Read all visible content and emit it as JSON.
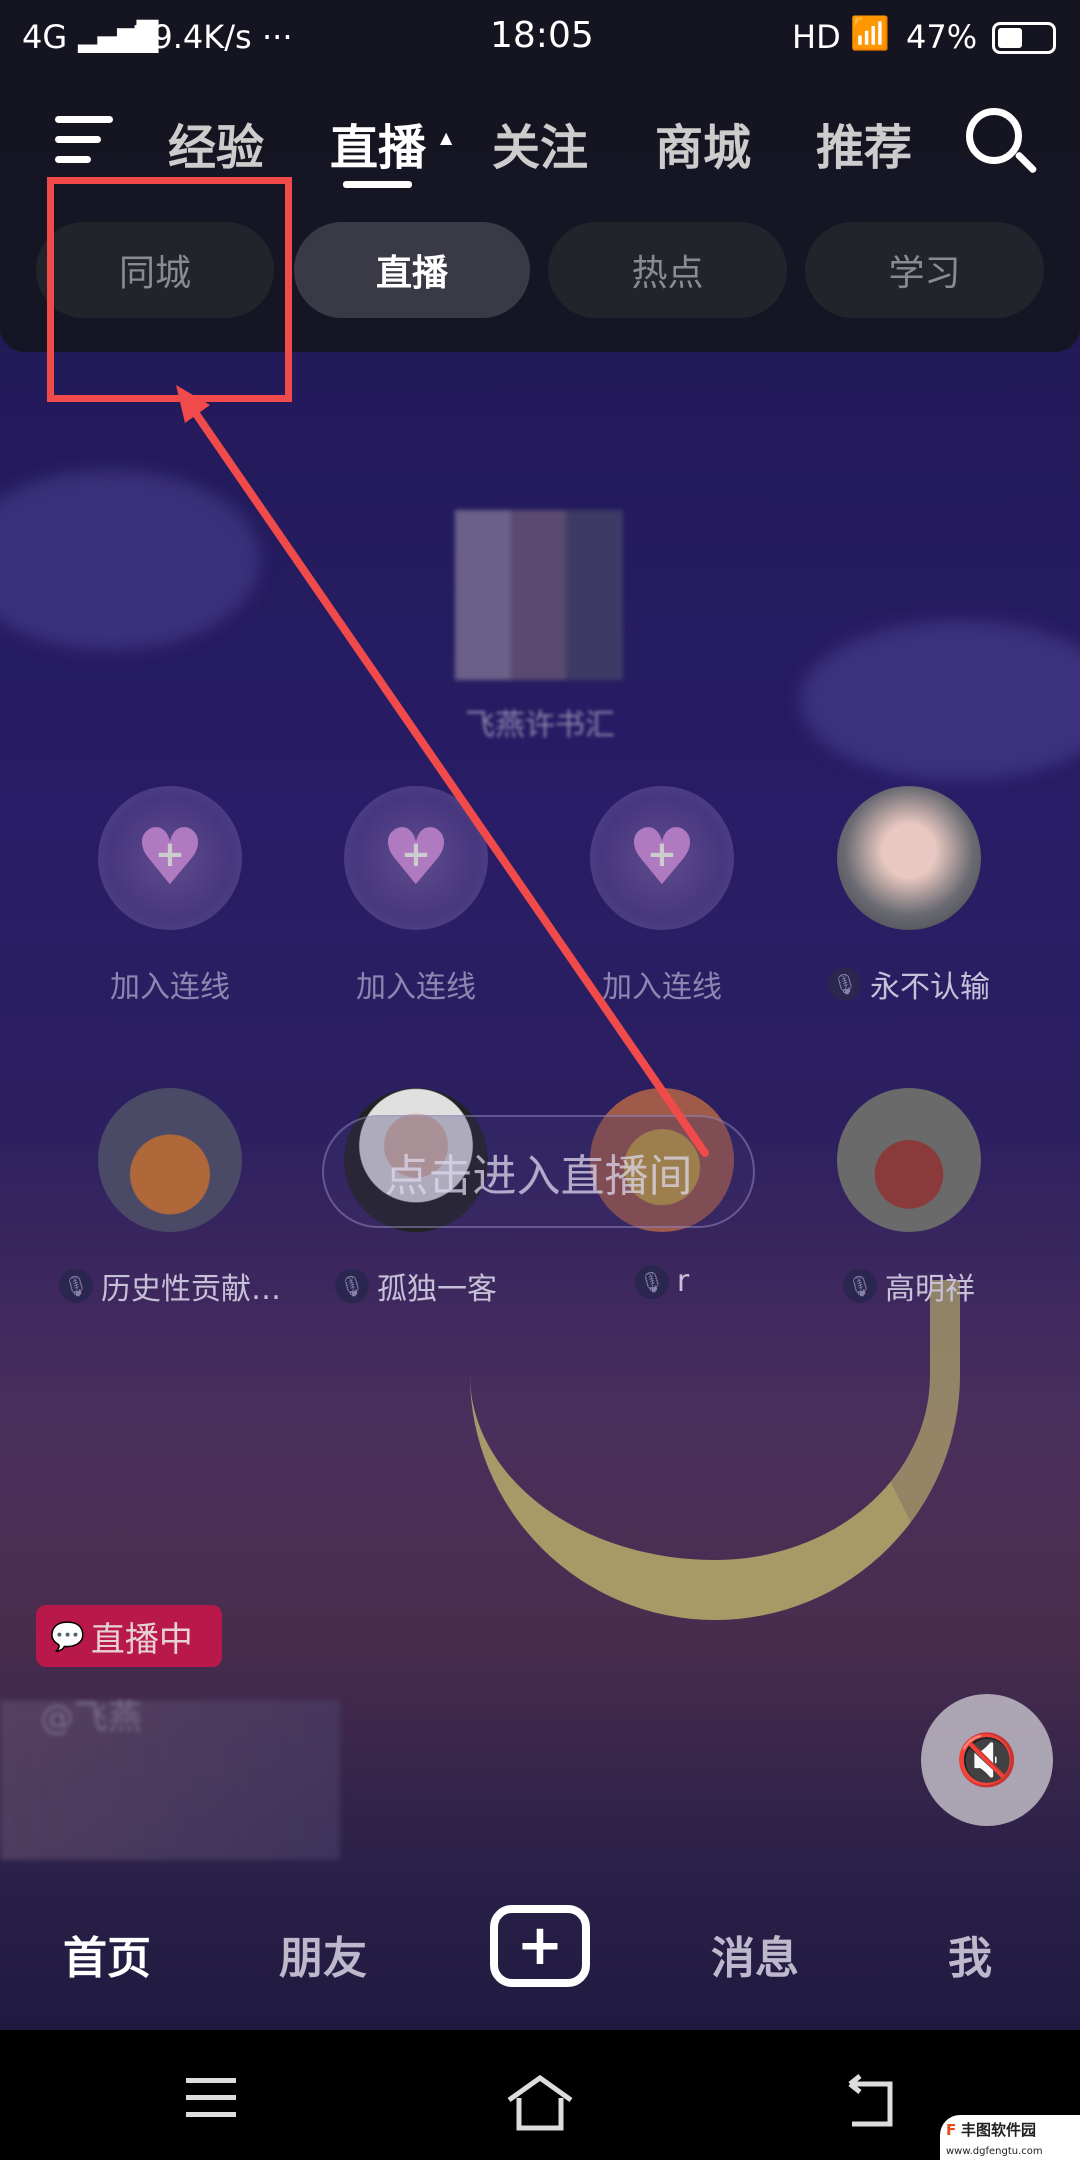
{
  "status_bar": {
    "network": "4G",
    "speed": "29.4K/s",
    "more": "···",
    "time": "18:05",
    "hd": "HD",
    "battery": "47%",
    "battery_level": 47
  },
  "top_tabs": {
    "items": [
      {
        "label": "经验"
      },
      {
        "label": "直播",
        "active": true
      },
      {
        "label": "关注"
      },
      {
        "label": "商城"
      },
      {
        "label": "推荐"
      }
    ],
    "menu_icon": "menu-icon",
    "search_icon": "search-icon"
  },
  "sub_tabs": {
    "items": [
      {
        "label": "同城"
      },
      {
        "label": "直播",
        "active": true
      },
      {
        "label": "热点"
      },
      {
        "label": "学习"
      }
    ]
  },
  "annotation": {
    "color": "#f04a4a"
  },
  "room": {
    "host_name": "飞燕许书汇",
    "enter_label": "点击进入直播间",
    "live_badge": "直播中",
    "host_handle": "@飞燕"
  },
  "seats": [
    {
      "label": "加入连线",
      "empty": true
    },
    {
      "label": "加入连线",
      "empty": true
    },
    {
      "label": "加入连线",
      "empty": true
    },
    {
      "label": "永不认输"
    },
    {
      "label": "历史性贡献…"
    },
    {
      "label": "孤独一客"
    },
    {
      "label": "r"
    },
    {
      "label": "高明祥"
    }
  ],
  "bottom_nav": {
    "items": [
      {
        "label": "首页",
        "active": true
      },
      {
        "label": "朋友"
      },
      {
        "label": "消息"
      },
      {
        "label": "我"
      }
    ],
    "plus_icon": "plus-icon"
  },
  "watermark": {
    "text": "丰图软件园",
    "url": "www.dgfengtu.com"
  }
}
